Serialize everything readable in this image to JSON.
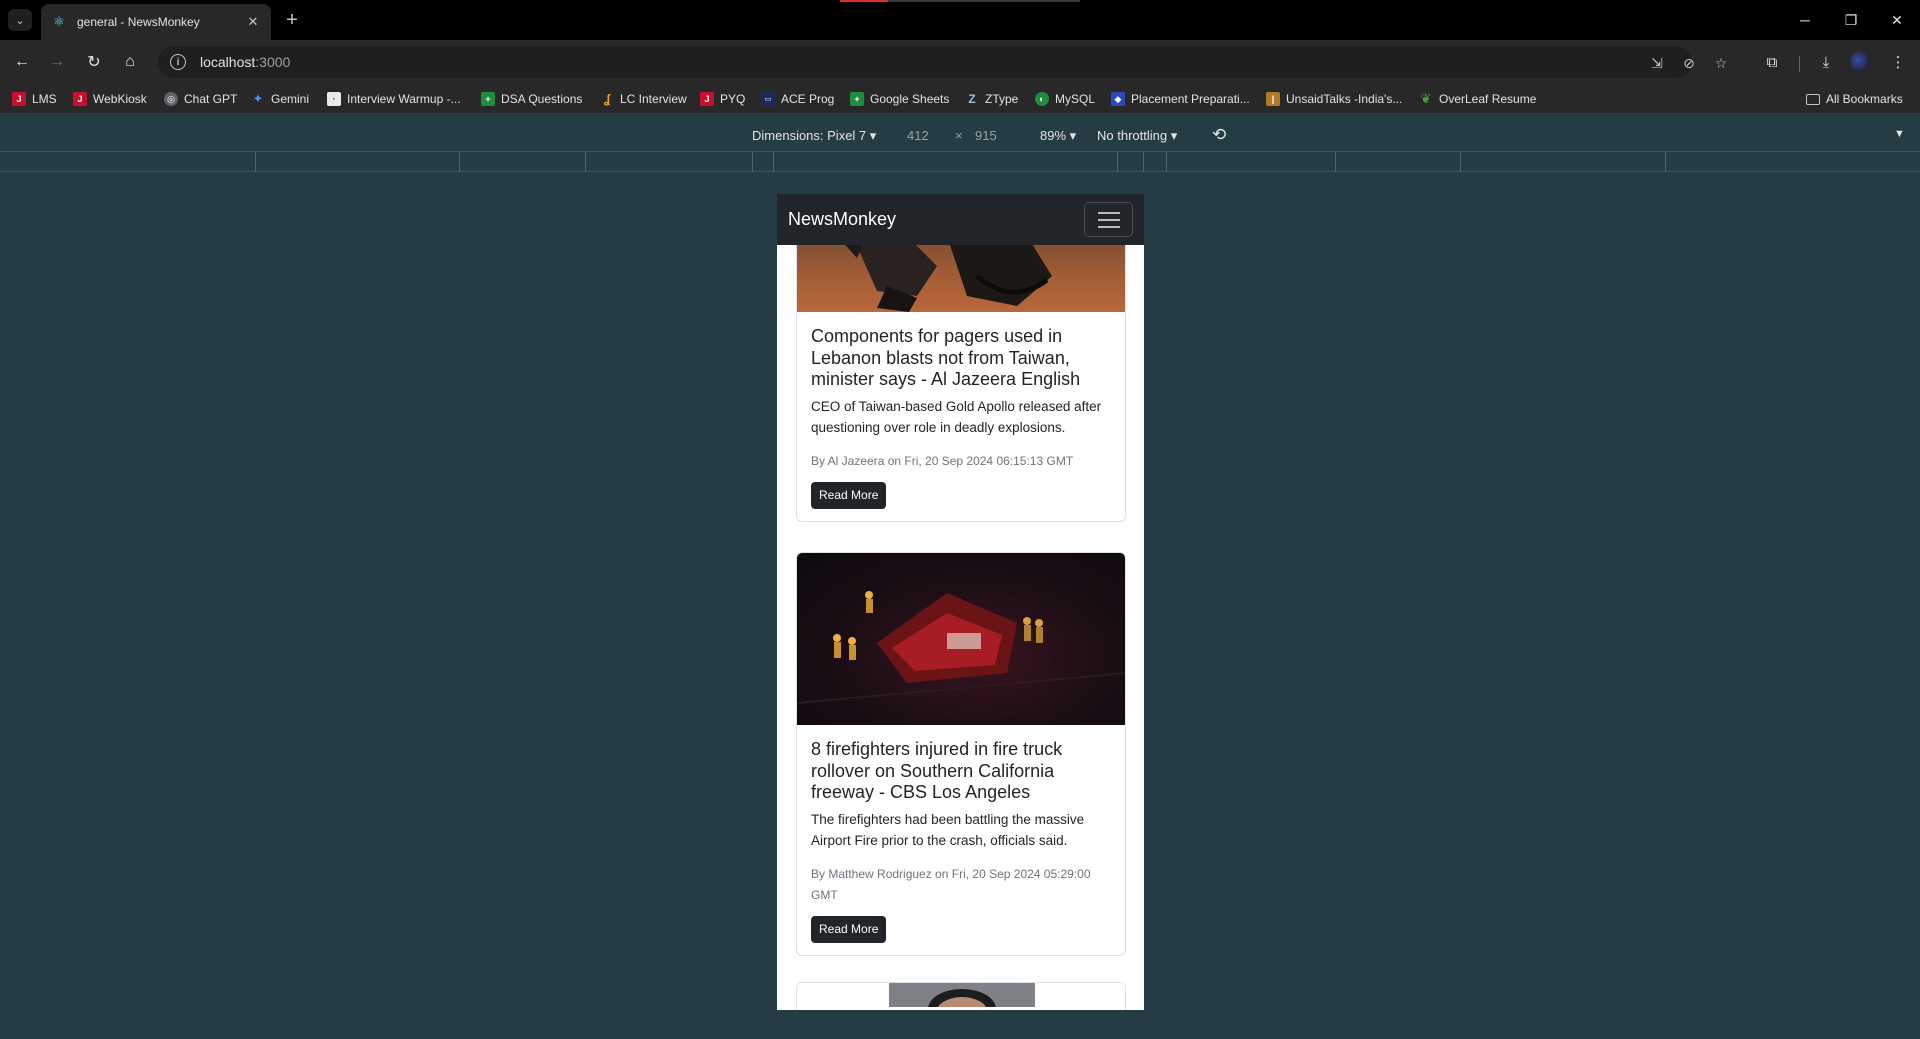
{
  "browser": {
    "tab_title": "general - NewsMonkey",
    "url_host": "localhost",
    "url_port": ":3000",
    "bookmarks": [
      "LMS",
      "WebKiosk",
      "Chat GPT",
      "Gemini",
      "Interview Warmup -...",
      "DSA Questions",
      "LC Interview",
      "PYQ",
      "ACE Prog",
      "Google Sheets",
      "ZType",
      "MySQL",
      "Placement Preparati...",
      "UnsaidTalks -India's...",
      "OverLeaf Resume"
    ],
    "all_bookmarks": "All Bookmarks"
  },
  "devtools": {
    "dimensions_label": "Dimensions: Pixel 7",
    "width": "412",
    "times": "×",
    "height": "915",
    "zoom": "89%",
    "throttling": "No throttling"
  },
  "app": {
    "brand": "NewsMonkey",
    "articles": [
      {
        "title": "Components for pagers used in Lebanon blasts not from Taiwan, minister says - Al Jazeera English",
        "description": "CEO of Taiwan-based Gold Apollo released after questioning over role in deadly explosions.",
        "meta": "By Al Jazeera on Fri, 20 Sep 2024 06:15:13 GMT",
        "button": "Read More"
      },
      {
        "title": "8 firefighters injured in fire truck rollover on Southern California freeway - CBS Los Angeles",
        "description": "The firefighters had been battling the massive Airport Fire prior to the crash, officials said.",
        "meta": "By Matthew Rodriguez on Fri, 20 Sep 2024 05:29:00 GMT",
        "button": "Read More"
      }
    ]
  },
  "colors": {
    "page_bg": "#263c44",
    "navbar": "#212529",
    "button": "#212529"
  }
}
